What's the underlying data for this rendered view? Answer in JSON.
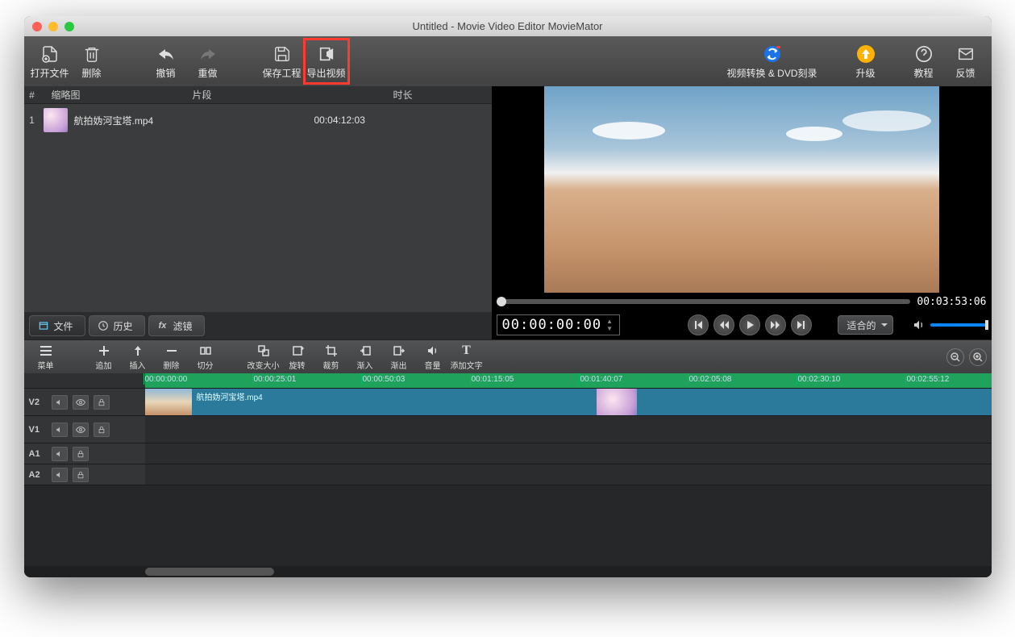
{
  "window": {
    "title": "Untitled - Movie Video Editor MovieMator"
  },
  "toolbar": {
    "open": "打开文件",
    "delete": "删除",
    "undo": "撤销",
    "redo": "重做",
    "save": "保存工程",
    "export": "导出视频",
    "convert": "视频转换 & DVD刻录",
    "upgrade": "升级",
    "tutorial": "教程",
    "feedback": "反馈"
  },
  "list": {
    "hdr_idx": "#",
    "hdr_thumb": "缩略图",
    "hdr_seg": "片段",
    "hdr_dur": "时长",
    "rows": [
      {
        "idx": "1",
        "name": "航拍妫河宝塔.mp4",
        "dur": "00:04:12:03"
      }
    ]
  },
  "panetabs": {
    "file": "文件",
    "history": "历史",
    "filter": "滤镜"
  },
  "preview": {
    "seek_time": "00:03:53:06",
    "timecode": "00:00:00:00",
    "zoom_fit": "适合的"
  },
  "tl_toolbar": {
    "menu": "菜单",
    "append": "追加",
    "insert": "插入",
    "delete": "删除",
    "split": "切分",
    "resize": "改变大小",
    "rotate": "旋转",
    "crop": "裁剪",
    "fadein": "渐入",
    "fadeout": "渐出",
    "volume": "音量",
    "text": "添加文字"
  },
  "ruler": {
    "ticks": [
      {
        "label": "00:00:00:00",
        "pos": 0
      },
      {
        "label": "00:00:25:01",
        "pos": 135
      },
      {
        "label": "00:00:50:03",
        "pos": 270
      },
      {
        "label": "00:01:15:05",
        "pos": 405
      },
      {
        "label": "00:01:40:07",
        "pos": 540
      },
      {
        "label": "00:02:05:08",
        "pos": 675
      },
      {
        "label": "00:02:30:10",
        "pos": 810
      },
      {
        "label": "00:02:55:12",
        "pos": 945
      }
    ]
  },
  "tracks": {
    "v2": "V2",
    "v1": "V1",
    "a1": "A1",
    "a2": "A2",
    "clip_name": "航拍妫河宝塔.mp4"
  }
}
